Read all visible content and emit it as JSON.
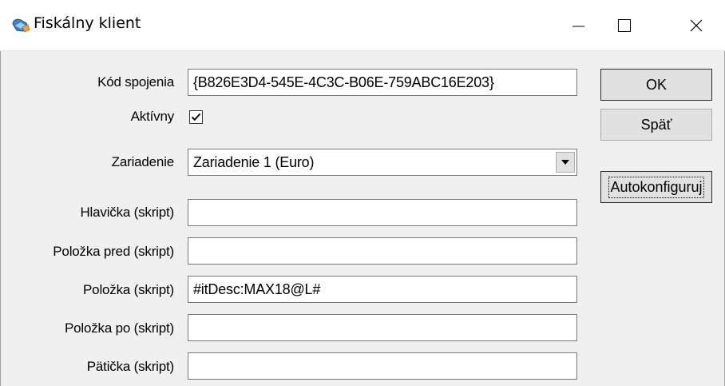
{
  "window": {
    "title": "Fiskálny klient",
    "minimize_glyph": "—",
    "maximize_glyph": "☐",
    "close_glyph": "✕"
  },
  "form": {
    "kod_spojenia": {
      "label": "Kód spojenia",
      "value": "{B826E3D4-545E-4C3C-B06E-759ABC16E203}"
    },
    "aktivny": {
      "label": "Aktívny",
      "checked": true
    },
    "zariadenie": {
      "label": "Zariadenie",
      "value": "Zariadenie 1 (Euro)"
    },
    "hlavicka": {
      "label": "Hlavička (skript)",
      "value": ""
    },
    "polozka_pred": {
      "label": "Položka pred (skript)",
      "value": ""
    },
    "polozka": {
      "label": "Položka (skript)",
      "value": "#itDesc:MAX18@L#"
    },
    "polozka_po": {
      "label": "Položka po (skript)",
      "value": ""
    },
    "paticka": {
      "label": "Pätička (skript)",
      "value": ""
    }
  },
  "buttons": {
    "ok": "OK",
    "spat": "Späť",
    "autokonfiguruj": "Autokonfiguruj"
  },
  "icons": {
    "app": "fiscal-client-icon",
    "dropdown": "chevron-down-icon",
    "check": "checkmark-icon"
  }
}
